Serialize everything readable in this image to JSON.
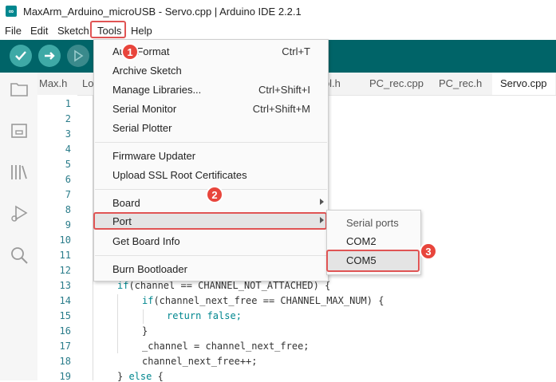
{
  "window": {
    "title": "MaxArm_Arduino_microUSB - Servo.cpp | Arduino IDE 2.2.1"
  },
  "menubar": {
    "items": [
      "File",
      "Edit",
      "Sketch",
      "Tools",
      "Help"
    ]
  },
  "tabs": [
    "Max.h",
    "Lo",
    "trol.h",
    "PC_rec.cpp",
    "PC_rec.h",
    "Servo.cpp"
  ],
  "line_numbers": [
    "1",
    "2",
    "3",
    "4",
    "5",
    "6",
    "7",
    "8",
    "9",
    "10",
    "11",
    "12",
    "13",
    "14",
    "15",
    "16",
    "17",
    "18",
    "19"
  ],
  "code": {
    "l13_kw": "if",
    "l13_rest": "(channel == CHANNEL_NOT_ATTACHED) {",
    "l14_kw": "if",
    "l14_rest": "(channel_next_free == CHANNEL_MAX_NUM) {",
    "l15_kw": "return",
    "l15_rest": " false;",
    "l16": "}",
    "l17": "_channel = channel_next_free;",
    "l18": "channel_next_free++;",
    "l19_a": "} ",
    "l19_kw": "else",
    "l19_b": " {"
  },
  "tools_menu": {
    "auto_format": {
      "label": "Auto Format",
      "shortcut": "Ctrl+T"
    },
    "archive_sketch": {
      "label": "Archive Sketch"
    },
    "manage_libraries": {
      "label": "Manage Libraries...",
      "shortcut": "Ctrl+Shift+I"
    },
    "serial_monitor": {
      "label": "Serial Monitor",
      "shortcut": "Ctrl+Shift+M"
    },
    "serial_plotter": {
      "label": "Serial Plotter"
    },
    "firmware_updater": {
      "label": "Firmware Updater"
    },
    "upload_ssl": {
      "label": "Upload SSL Root Certificates"
    },
    "board": {
      "label": "Board"
    },
    "port": {
      "label": "Port"
    },
    "get_board_info": {
      "label": "Get Board Info"
    },
    "burn_bootloader": {
      "label": "Burn Bootloader"
    }
  },
  "port_submenu": {
    "header": "Serial ports",
    "items": [
      "COM2",
      "COM5"
    ]
  },
  "badges": [
    "1",
    "2",
    "3"
  ],
  "colors": {
    "toolbar": "#006468",
    "accent": "#00878f",
    "highlight_border": "#e05454",
    "badge": "#e8453c"
  },
  "icons": [
    "verify-icon",
    "upload-icon",
    "debug-icon",
    "sketchbook-icon",
    "boards-manager-icon",
    "library-manager-icon",
    "debug-sidebar-icon",
    "search-icon"
  ]
}
